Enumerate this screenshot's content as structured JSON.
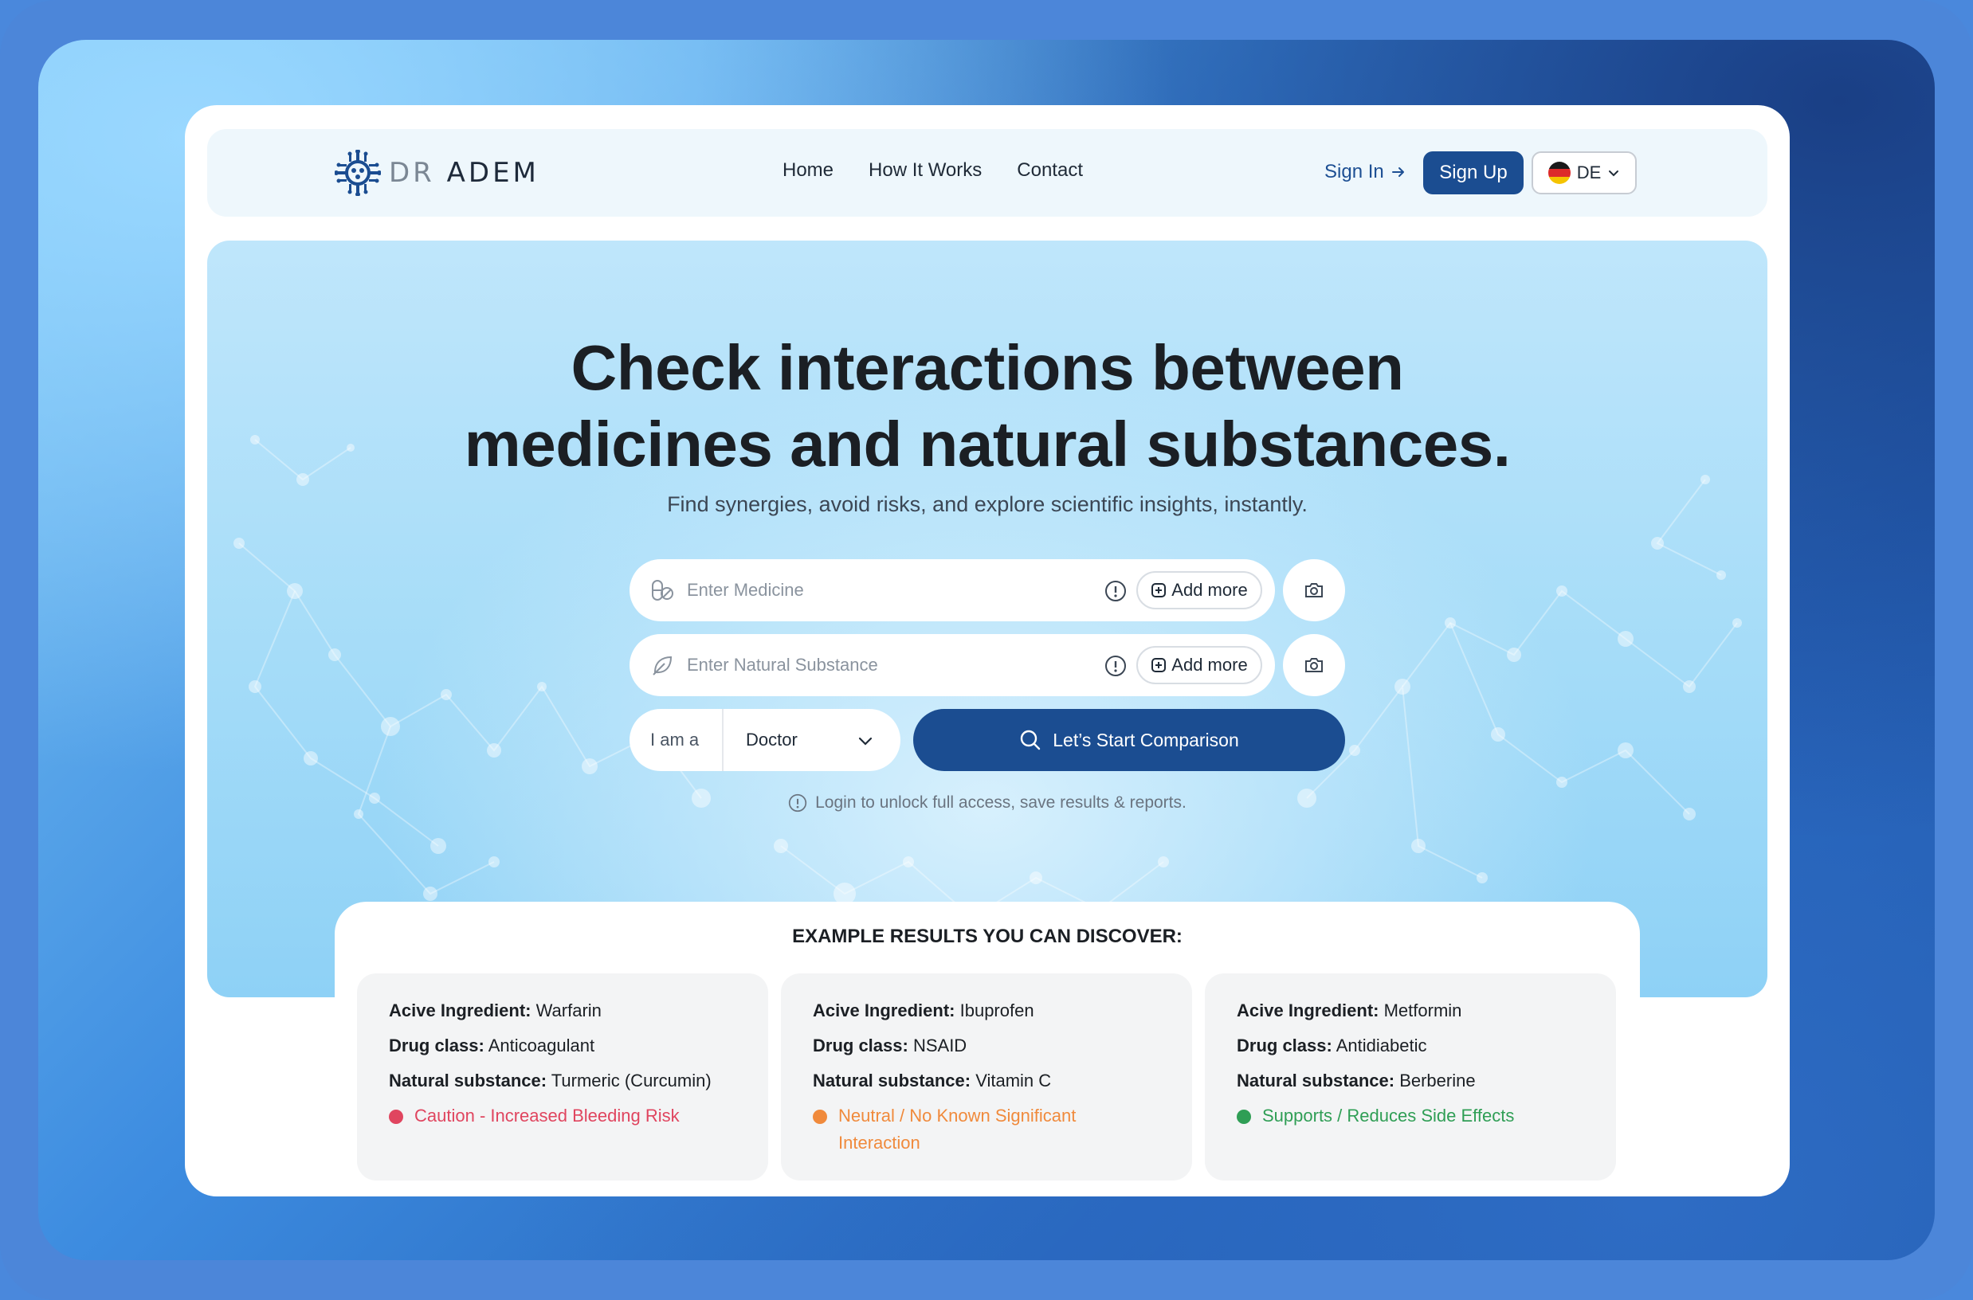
{
  "brand": {
    "logo_dr": "DR",
    "logo_name": "ADEM"
  },
  "nav": {
    "links": [
      "Home",
      "How It Works",
      "Contact"
    ],
    "signin": "Sign In",
    "signup": "Sign Up",
    "language": "DE"
  },
  "hero": {
    "headline_line1": "Check interactions between",
    "headline_line2": "medicines and natural substances.",
    "subline": "Find synergies, avoid risks, and explore scientific insights, instantly.",
    "medicine_placeholder": "Enter Medicine",
    "substance_placeholder": "Enter Natural Substance",
    "add_more": "Add more",
    "role_label": "I am a",
    "role_value": "Doctor",
    "start_button": "Let’s Start Comparison",
    "login_note": "Login to unlock full access, save results & reports."
  },
  "examples": {
    "title": "EXAMPLE RESULTS YOU CAN DISCOVER:",
    "labels": {
      "ingredient": "Acive Ingredient:",
      "drug_class": "Drug class:",
      "natural": "Natural substance:"
    },
    "cards": [
      {
        "ingredient": "Warfarin",
        "drug_class": "Anticoagulant",
        "natural": "Turmeric (Curcumin)",
        "status": "Caution - Increased Bleeding Risk",
        "status_color": "#e0455f"
      },
      {
        "ingredient": "Ibuprofen",
        "drug_class": "NSAID",
        "natural": "Vitamin C",
        "status": "Neutral / No Known Significant Interaction",
        "status_color": "#f08a3c"
      },
      {
        "ingredient": "Metformin",
        "drug_class": "Antidiabetic",
        "natural": "Berberine",
        "status": "Supports / Reduces Side Effects",
        "status_color": "#2f9e55"
      }
    ]
  },
  "colors": {
    "primary": "#1b4d91",
    "frame": "#4c86d9"
  }
}
